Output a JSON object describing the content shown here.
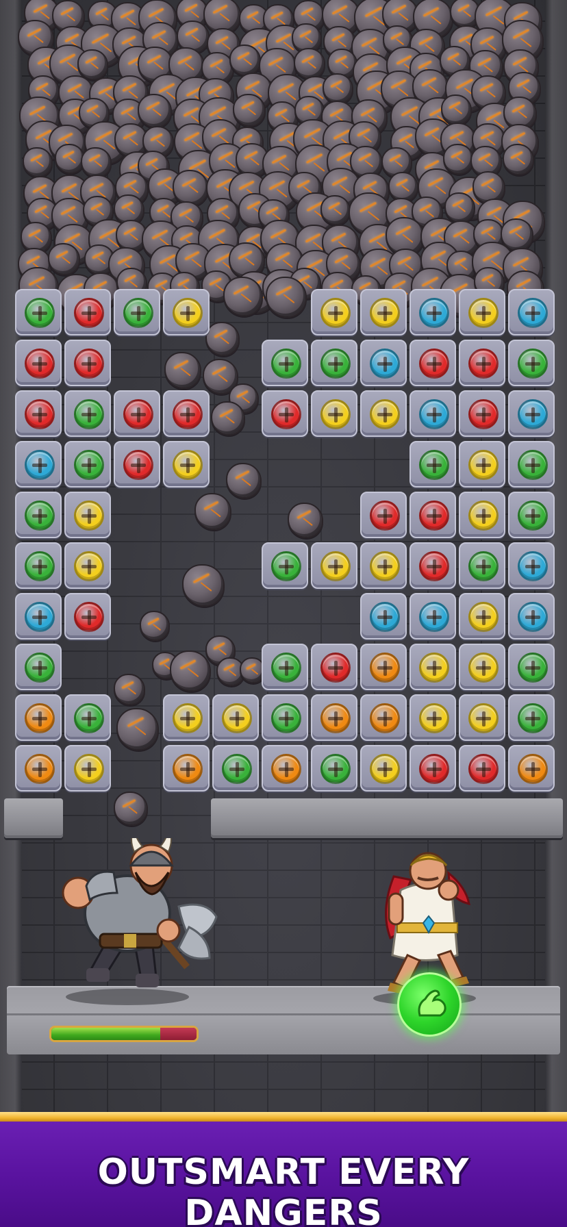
{
  "banner": {
    "text": "OUTSMART EVERY DANGERS"
  },
  "colors": {
    "green": "#39b23a",
    "red": "#e02a2a",
    "yellow": "#f4cf1e",
    "blue": "#2ea9d6",
    "orange": "#f08a12",
    "banner_purple": "#5a13a0",
    "banner_gold": "#f2b732"
  },
  "board": {
    "columns": 11,
    "rows": [
      [
        "green",
        "red",
        "green",
        "yellow",
        null,
        null,
        "yellow",
        "yellow",
        "blue",
        "yellow",
        "blue"
      ],
      [
        "red",
        "red",
        null,
        null,
        null,
        "green",
        "green",
        "blue",
        "red",
        "red",
        "green"
      ],
      [
        "red",
        "green",
        "red",
        "red",
        null,
        "red",
        "yellow",
        "yellow",
        "blue",
        "red",
        "blue"
      ],
      [
        "blue",
        "green",
        "red",
        "yellow",
        null,
        null,
        null,
        null,
        "green",
        "yellow",
        "green"
      ],
      [
        "green",
        "yellow",
        null,
        null,
        null,
        null,
        null,
        "red",
        "red",
        "yellow",
        "green"
      ],
      [
        "green",
        "yellow",
        null,
        null,
        null,
        "green",
        "yellow",
        "yellow",
        "red",
        "green",
        "blue"
      ],
      [
        "blue",
        "red",
        null,
        null,
        null,
        null,
        null,
        "blue",
        "blue",
        "yellow",
        "blue"
      ],
      [
        "green",
        null,
        null,
        null,
        null,
        "green",
        "red",
        "orange",
        "yellow",
        "yellow",
        "green"
      ],
      [
        "orange",
        "green",
        null,
        "yellow",
        "yellow",
        "green",
        "orange",
        "orange",
        "yellow",
        "yellow",
        "green"
      ],
      [
        "orange",
        "yellow",
        null,
        "orange",
        "green",
        "orange",
        "green",
        "yellow",
        "red",
        "red",
        "orange"
      ]
    ]
  },
  "enemy": {
    "name": "viking-warrior",
    "icon": "viking-icon"
  },
  "hero": {
    "name": "roman-hero",
    "icon": "hero-icon"
  },
  "health_bar": {
    "value": 0.75
  },
  "power_button": {
    "icon": "flexed-arm-icon"
  }
}
